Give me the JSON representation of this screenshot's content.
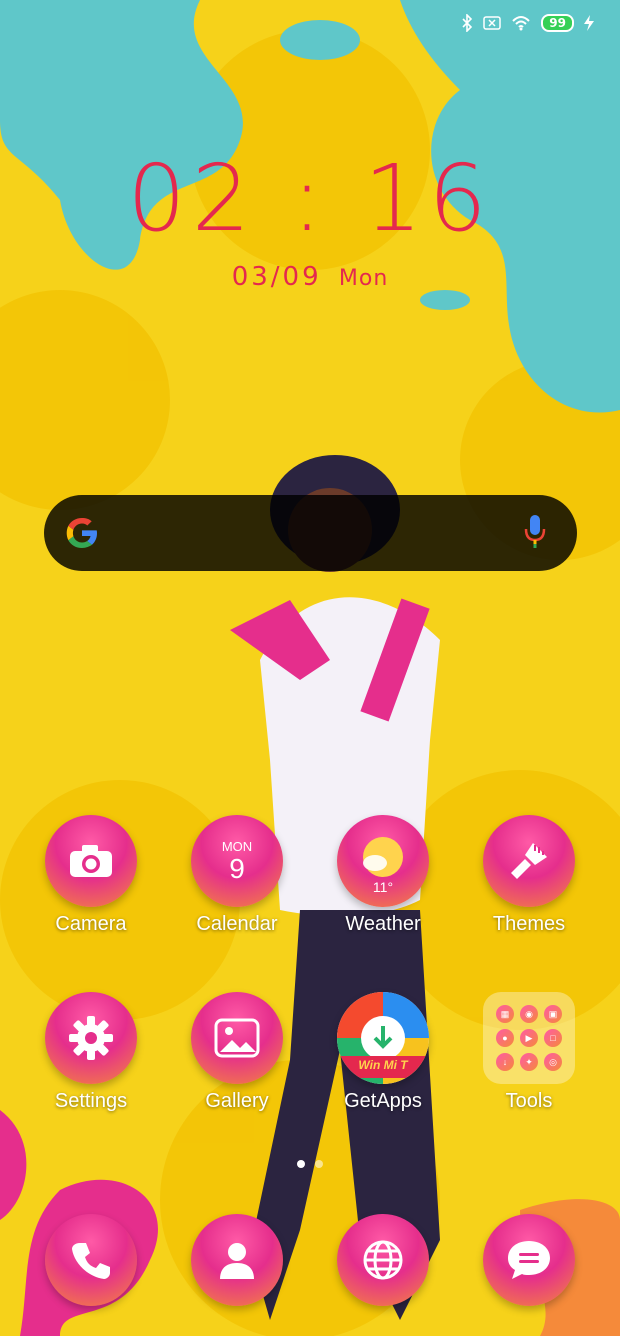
{
  "status_bar": {
    "icons": [
      "bluetooth-icon",
      "sim-icon",
      "wifi-icon"
    ],
    "battery": "99"
  },
  "clock": {
    "time": "02 : 16",
    "date": "03/09",
    "weekday": "Mon"
  },
  "search_bar": {
    "icons": [
      "google-logo",
      "mic-icon"
    ]
  },
  "apps_row1": [
    {
      "label": "Camera",
      "icon": "camera-icon"
    },
    {
      "label": "Calendar",
      "month": "MON",
      "day": "9"
    },
    {
      "label": "Weather",
      "temp": "11°"
    },
    {
      "label": "Themes",
      "icon": "brush-icon"
    }
  ],
  "apps_row2": [
    {
      "label": "Settings",
      "icon": "gear-icon"
    },
    {
      "label": "Gallery",
      "icon": "image-icon"
    },
    {
      "label": "GetApps",
      "badge": "Win Mi T"
    },
    {
      "label": "Tools",
      "icon": "folder-icon"
    }
  ],
  "dock": [
    {
      "icon": "phone-icon"
    },
    {
      "icon": "contacts-icon"
    },
    {
      "icon": "browser-icon"
    },
    {
      "icon": "messages-icon"
    }
  ],
  "colors": {
    "accent": "#e4284e",
    "background": "#f6d21a",
    "splash": "#5fc7c9"
  }
}
